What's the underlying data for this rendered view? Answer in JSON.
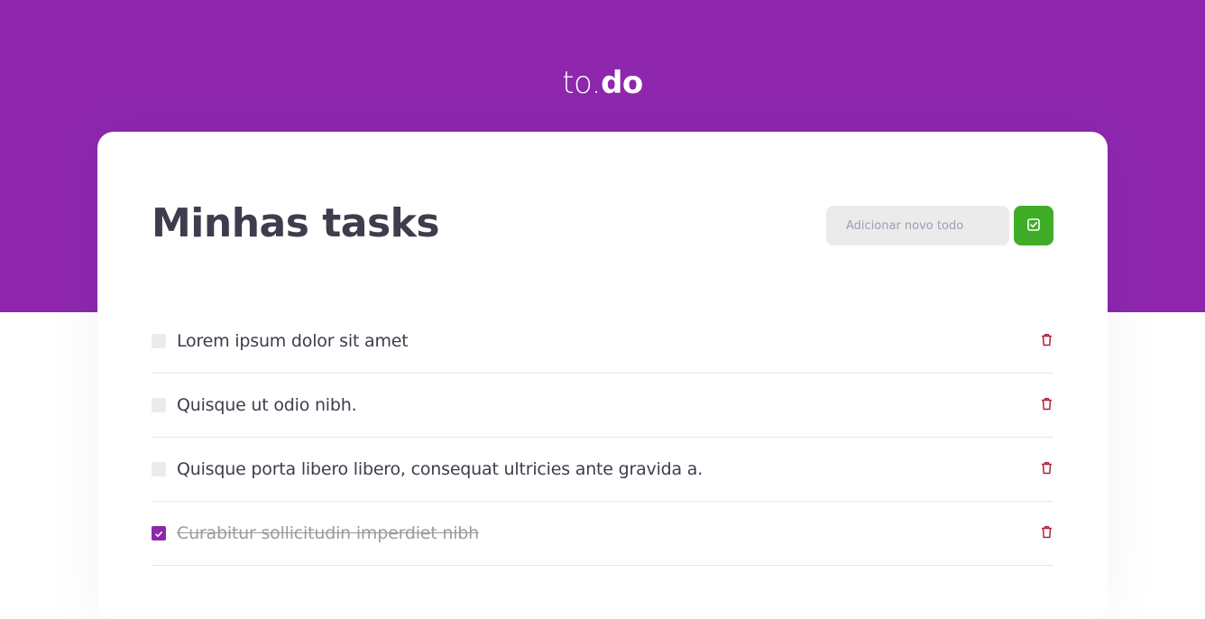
{
  "logo": {
    "light": "to.",
    "bold": "do"
  },
  "main": {
    "title": "Minhas tasks",
    "new_todo": {
      "value": "",
      "placeholder": "Adicionar novo todo"
    },
    "add_icon": "checkbox-check-icon",
    "delete_icon": "trash-icon",
    "colors": {
      "brand": "#8e27ae",
      "add_button": "#3fad27",
      "delete": "#b3203c",
      "text": "#3d3d4d"
    }
  },
  "tasks": [
    {
      "text": "Lorem ipsum dolor sit amet",
      "done": false
    },
    {
      "text": "Quisque ut odio nibh.",
      "done": false
    },
    {
      "text": "Quisque porta libero libero, consequat ultricies ante gravida a.",
      "done": false
    },
    {
      "text": "Curabitur sollicitudin imperdiet nibh",
      "done": true
    }
  ]
}
